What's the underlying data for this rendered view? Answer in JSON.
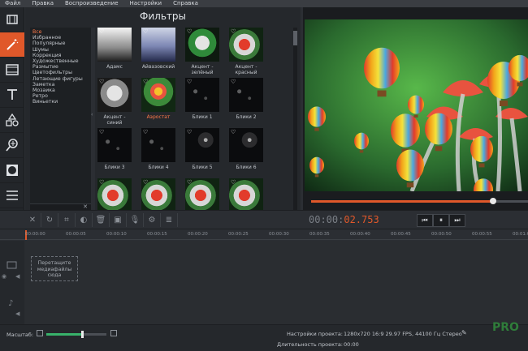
{
  "menu": [
    "Файл",
    "Правка",
    "Воспроизведение",
    "Настройки",
    "Справка"
  ],
  "tools": [
    {
      "icon": "film-clip-icon",
      "active": false
    },
    {
      "icon": "magic-wand-icon",
      "active": true
    },
    {
      "icon": "film-strip-icon",
      "active": false
    },
    {
      "icon": "text-icon",
      "active": false
    },
    {
      "icon": "shapes-icon",
      "active": false
    },
    {
      "icon": "zoom-icon",
      "active": false
    },
    {
      "icon": "vignette-icon",
      "active": false
    },
    {
      "icon": "list-icon",
      "active": false
    }
  ],
  "filters_panel": {
    "title": "Фильтры",
    "categories": [
      "Все",
      "Избранное",
      "Популярные",
      "Шумы",
      "Коррекция",
      "Художественные",
      "Размытие",
      "Цветофильтры",
      "Летающие фигуры",
      "Заметка",
      "Мозаика",
      "Ретро",
      "Виньетки"
    ],
    "selected_category": "Все",
    "tiles": [
      {
        "label": "Адамс",
        "style": "adams",
        "selected": false
      },
      {
        "label": "Айвазовский",
        "style": "aivazovsky",
        "selected": false
      },
      {
        "label": "Акцент - зелёный",
        "style": "accent-green",
        "selected": false
      },
      {
        "label": "Акцент - красный",
        "style": "accent-red",
        "selected": false
      },
      {
        "label": "Акцент - синий",
        "style": "accent-blue",
        "selected": false
      },
      {
        "label": "Аэростат",
        "style": "balloon",
        "selected": true
      },
      {
        "label": "Блики 1",
        "style": "bokeh",
        "selected": false
      },
      {
        "label": "Блики 2",
        "style": "bokeh",
        "selected": false
      },
      {
        "label": "Блики 3",
        "style": "bokeh",
        "selected": false
      },
      {
        "label": "Блики 4",
        "style": "bokeh",
        "selected": false
      },
      {
        "label": "Блики 5",
        "style": "flare",
        "selected": false
      },
      {
        "label": "Блики 6",
        "style": "flare",
        "selected": false
      },
      {
        "label": "",
        "style": "accent-red",
        "selected": false
      },
      {
        "label": "",
        "style": "accent-red",
        "selected": false
      },
      {
        "label": "",
        "style": "accent-red",
        "selected": false
      },
      {
        "label": "",
        "style": "accent-red",
        "selected": false
      }
    ]
  },
  "player": {
    "timecode_main": "00:00:",
    "timecode_ms": "02.753",
    "progress_fraction": 0.84,
    "buttons": {
      "prev": "⏮",
      "pause": "⏸",
      "next": "⏭"
    }
  },
  "timeline": {
    "ticks": [
      "00:00:00",
      "00:00:05",
      "00:00:10",
      "00:00:15",
      "00:00:20",
      "00:00:25",
      "00:00:30",
      "00:00:35",
      "00:00:40",
      "00:00:45",
      "00:00:50",
      "00:00:55",
      "00:01:0"
    ],
    "drop_hint": "Перетащите медиафайлы сюда"
  },
  "bottom": {
    "zoom_label": "Масштаб:",
    "zoom_fraction": 0.6,
    "project_settings_label": "Настройки проекта:",
    "project_settings_value": "1280x720 16:9 29.97 FPS, 44100 Гц Стерео",
    "project_duration_label": "Длительность проекта:",
    "project_duration_value": "00:00"
  },
  "colors": {
    "accent": "#e0582a",
    "zoom": "#38b26a"
  }
}
